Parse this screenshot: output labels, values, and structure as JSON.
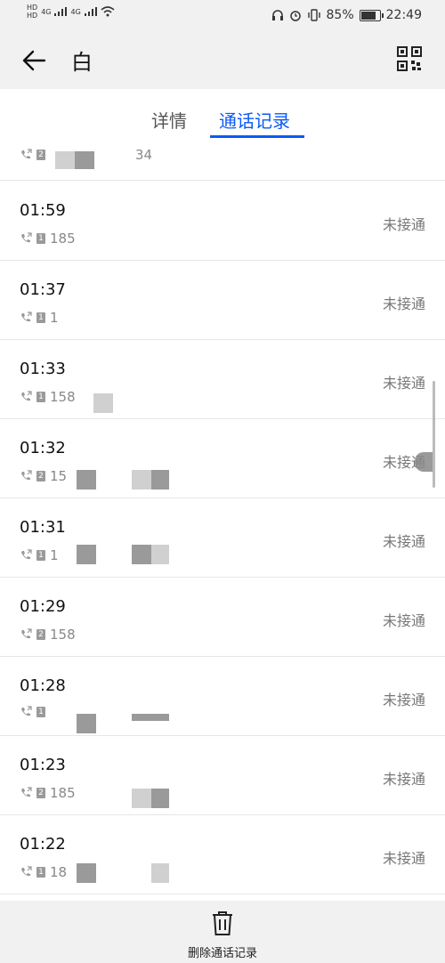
{
  "status_bar": {
    "left_hd1": "HD",
    "left_hd2": "HD",
    "net1": "4G",
    "net2": "4G",
    "battery": "85%",
    "time": "22:49"
  },
  "header": {
    "title": "白",
    "back_icon": "arrow-left-icon",
    "qr_icon": "qr-code-icon"
  },
  "tabs": [
    {
      "label": "详情"
    },
    {
      "label": "通话记录"
    }
  ],
  "first_row": {
    "number_partial": "34"
  },
  "calls": [
    {
      "time": "01:59",
      "sim": "1",
      "number_partial": "185",
      "status": "未接通"
    },
    {
      "time": "01:37",
      "sim": "1",
      "number_partial": "1",
      "status": "未接通"
    },
    {
      "time": "01:33",
      "sim": "1",
      "number_partial": "158",
      "status": "未接通"
    },
    {
      "time": "01:32",
      "sim": "2",
      "number_partial": "15",
      "status": "未接通"
    },
    {
      "time": "01:31",
      "sim": "1",
      "number_partial": "1",
      "status": "未接通"
    },
    {
      "time": "01:29",
      "sim": "2",
      "number_partial": "158",
      "status": "未接通"
    },
    {
      "time": "01:28",
      "sim": "1",
      "number_partial": "",
      "status": "未接通"
    },
    {
      "time": "01:23",
      "sim": "2",
      "number_partial": "185",
      "status": "未接通"
    },
    {
      "time": "01:22",
      "sim": "1",
      "number_partial": "18",
      "status": "未接通"
    }
  ],
  "bottom": {
    "delete_label": "删除通话记录",
    "delete_icon": "trash-icon"
  },
  "colors": {
    "accent": "#0a59f7",
    "background": "#f1f1f1"
  }
}
